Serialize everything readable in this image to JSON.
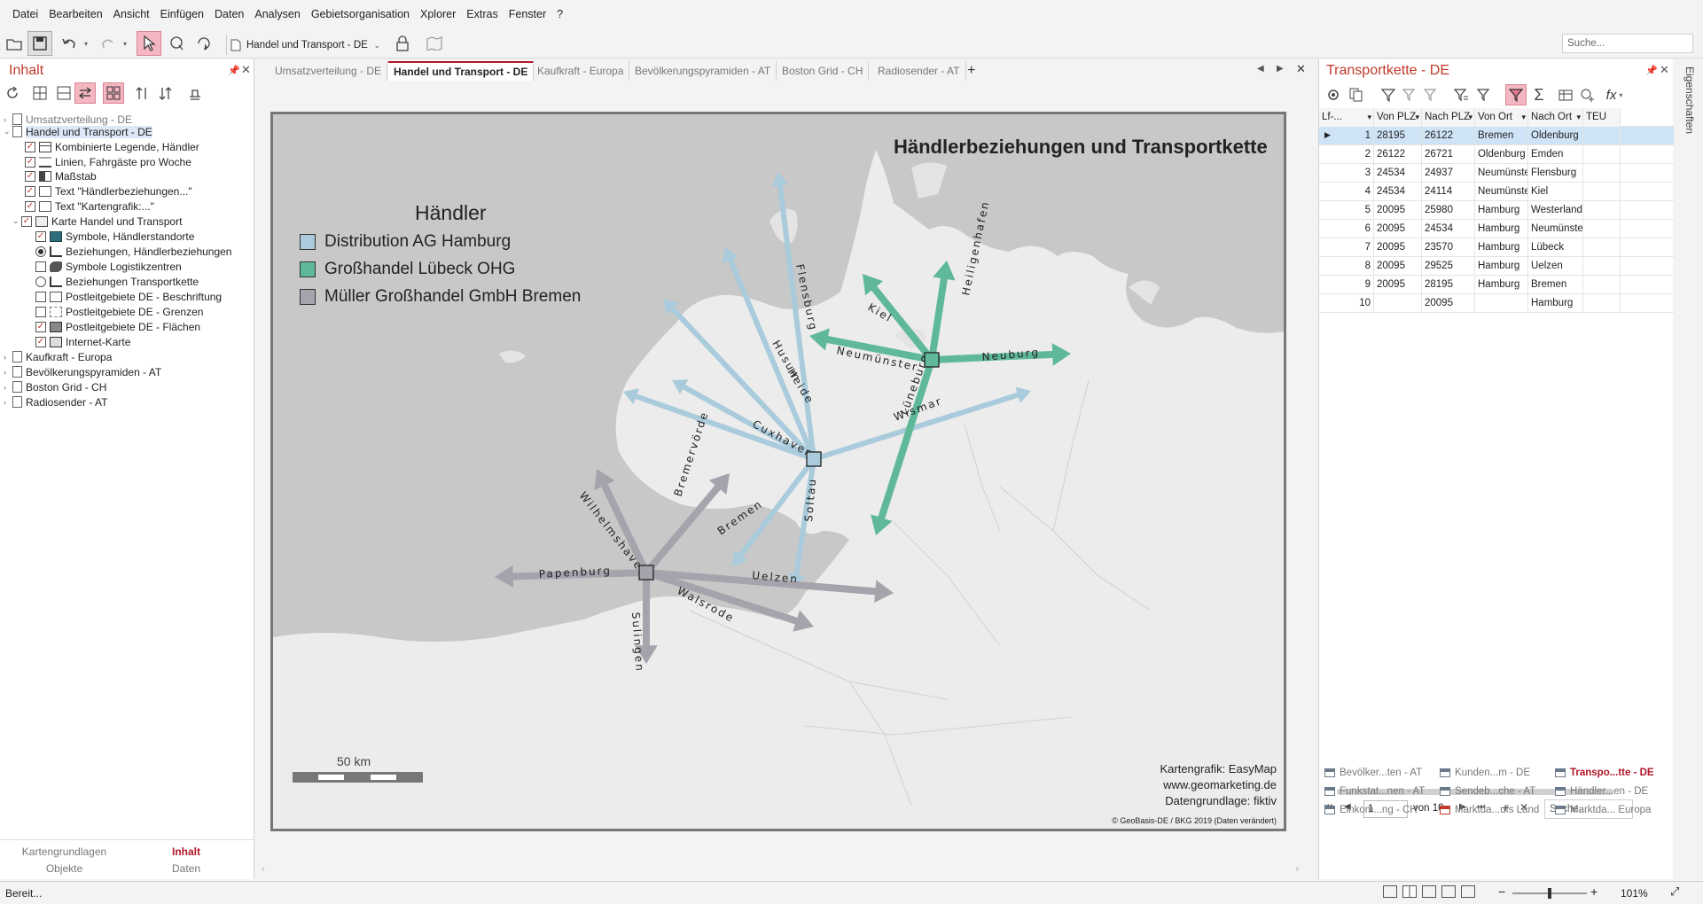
{
  "menu": [
    "Datei",
    "Bearbeiten",
    "Ansicht",
    "Einfügen",
    "Daten",
    "Analysen",
    "Gebietsorganisation",
    "Xplorer",
    "Extras",
    "Fenster",
    "?"
  ],
  "toolbar": {
    "map_selector": "Handel und Transport - DE",
    "search_placeholder": "Suche..."
  },
  "left_panel": {
    "title": "Inhalt",
    "tree": [
      {
        "label": "Umsatzverteilung - DE",
        "level": 0,
        "kind": "page",
        "grey": true
      },
      {
        "label": "Handel und Transport - DE",
        "level": 0,
        "kind": "page",
        "selected": true
      },
      {
        "label": "Kombinierte Legende, Händler",
        "level": 1,
        "kind": "check",
        "checked": true,
        "icon": "legend-icon"
      },
      {
        "label": "Linien, Fahrgäste pro Woche",
        "level": 1,
        "kind": "check",
        "checked": true,
        "icon": "lines-icon"
      },
      {
        "label": "Maßstab",
        "level": 1,
        "kind": "check",
        "checked": true,
        "icon": "scale-icon"
      },
      {
        "label": "Text \"Händlerbeziehungen...\"",
        "level": 1,
        "kind": "check",
        "checked": true,
        "icon": "text-icon"
      },
      {
        "label": "Text \"Kartengrafik:...\"",
        "level": 1,
        "kind": "check",
        "checked": true,
        "icon": "text-icon"
      },
      {
        "label": "Karte Handel und Transport",
        "level": 1,
        "kind": "check",
        "checked": true,
        "icon": "map-icon",
        "expander": true
      },
      {
        "label": "Symbole, Händlerstandorte",
        "level": 2,
        "kind": "check",
        "checked": true,
        "icon": "symbols-icon"
      },
      {
        "label": "Beziehungen,  Händlerbeziehungen",
        "level": 2,
        "kind": "radio",
        "checked": true,
        "icon": "relations-icon"
      },
      {
        "label": "Symbole Logistikzentren",
        "level": 2,
        "kind": "check",
        "checked": false,
        "icon": "symbols-grey-icon"
      },
      {
        "label": "Beziehungen Transportkette",
        "level": 2,
        "kind": "radio",
        "checked": false,
        "icon": "relations-icon"
      },
      {
        "label": "Postleitgebiete DE - Beschriftung",
        "level": 2,
        "kind": "check",
        "checked": false,
        "icon": "label-icon"
      },
      {
        "label": "Postleitgebiete DE - Grenzen",
        "level": 2,
        "kind": "check",
        "checked": false,
        "icon": "borders-icon"
      },
      {
        "label": "Postleitgebiete DE - Flächen",
        "level": 2,
        "kind": "check",
        "checked": true,
        "icon": "area-icon"
      },
      {
        "label": "Internet-Karte",
        "level": 2,
        "kind": "check",
        "checked": true,
        "icon": "web-map-icon"
      },
      {
        "label": "Kaufkraft - Europa",
        "level": 0,
        "kind": "page"
      },
      {
        "label": "Bevölkerungspyramiden - AT",
        "level": 0,
        "kind": "page"
      },
      {
        "label": "Boston Grid - CH",
        "level": 0,
        "kind": "page"
      },
      {
        "label": "Radiosender - AT",
        "level": 0,
        "kind": "page"
      }
    ],
    "footer_tabs": [
      "Kartengrundlagen",
      "Inhalt",
      "Objekte",
      "Daten"
    ]
  },
  "doc_tabs": [
    "Umsatzverteilung - DE",
    "Handel und Transport - DE",
    "Kaufkraft - Europa",
    "Bevölkerungspyramiden - AT",
    "Boston Grid - CH",
    "Radiosender - AT"
  ],
  "map": {
    "title": "Händlerbeziehungen und Transportkette",
    "legend": {
      "title": "Händler",
      "items": [
        {
          "label": "Distribution AG Hamburg",
          "color": "#a9cbdb"
        },
        {
          "label": "Großhandel Lübeck OHG",
          "color": "#5fb998"
        },
        {
          "label": "Müller Großhandel GmbH Bremen",
          "color": "#a7a3ad"
        }
      ]
    },
    "scale_label": "50 km",
    "credits": [
      "Kartengrafik: EasyMap",
      "www.geomarketing.de",
      "Datengrundlage: fiktiv"
    ],
    "copyright": "© GeoBasis-DE / BKG 2019 (Daten verändert)",
    "route_labels": {
      "hamburg": [
        "Flensburg",
        "Husum",
        "Heide",
        "Cuxhaven",
        "Bremen",
        "Soltau",
        "Wismar"
      ],
      "luebeck": [
        "Kiel",
        "Neumünster",
        "Heiligenhafen",
        "Neuburg",
        "Lüneburg"
      ],
      "bremen": [
        "Wilhelmshaven",
        "Bremervörde",
        "Papenburg",
        "Sulingen",
        "Walsrode",
        "Uelzen"
      ]
    },
    "colors": {
      "hamburg": "#a9cbdb",
      "luebeck": "#5fb998",
      "bremen": "#a7a3ad"
    }
  },
  "right_panel": {
    "title": "Transportkette - DE",
    "columns": [
      "Lf-...",
      "Von PLZ",
      "Nach PLZ",
      "Von Ort",
      "Nach Ort",
      "TEU"
    ],
    "rows": [
      [
        "1",
        "28195",
        "26122",
        "Bremen",
        "Oldenburg",
        ""
      ],
      [
        "2",
        "26122",
        "26721",
        "Oldenburg",
        "Emden",
        ""
      ],
      [
        "3",
        "24534",
        "24937",
        "Neumünster",
        "Flensburg",
        ""
      ],
      [
        "4",
        "24534",
        "24114",
        "Neumünster",
        "Kiel",
        ""
      ],
      [
        "5",
        "20095",
        "25980",
        "Hamburg",
        "Westerland",
        ""
      ],
      [
        "6",
        "20095",
        "24534",
        "Hamburg",
        "Neumünster",
        ""
      ],
      [
        "7",
        "20095",
        "23570",
        "Hamburg",
        "Lübeck",
        ""
      ],
      [
        "8",
        "20095",
        "29525",
        "Hamburg",
        "Uelzen",
        ""
      ],
      [
        "9",
        "20095",
        "28195",
        "Hamburg",
        "Bremen",
        ""
      ],
      [
        "10",
        "",
        "20095",
        "",
        "Hamburg",
        ""
      ]
    ],
    "pager": {
      "current": "1",
      "of_label": "von 10",
      "search_placeholder": "Suche..."
    },
    "bottom_tabs": [
      [
        "Bevölker...ten - AT",
        "Kunden...m - DE",
        "Transpo...tte - DE"
      ],
      [
        "Funkstat...nen - AT",
        "Sendeb...che - AT",
        "Händler...en - DE"
      ],
      [
        "Einkom...ng - CH",
        "Marktda...ufs Land",
        "Marktda... Europa"
      ]
    ]
  },
  "side_tab": "Eigenschaften",
  "status": {
    "text": "Bereit...",
    "zoom": "101%"
  }
}
